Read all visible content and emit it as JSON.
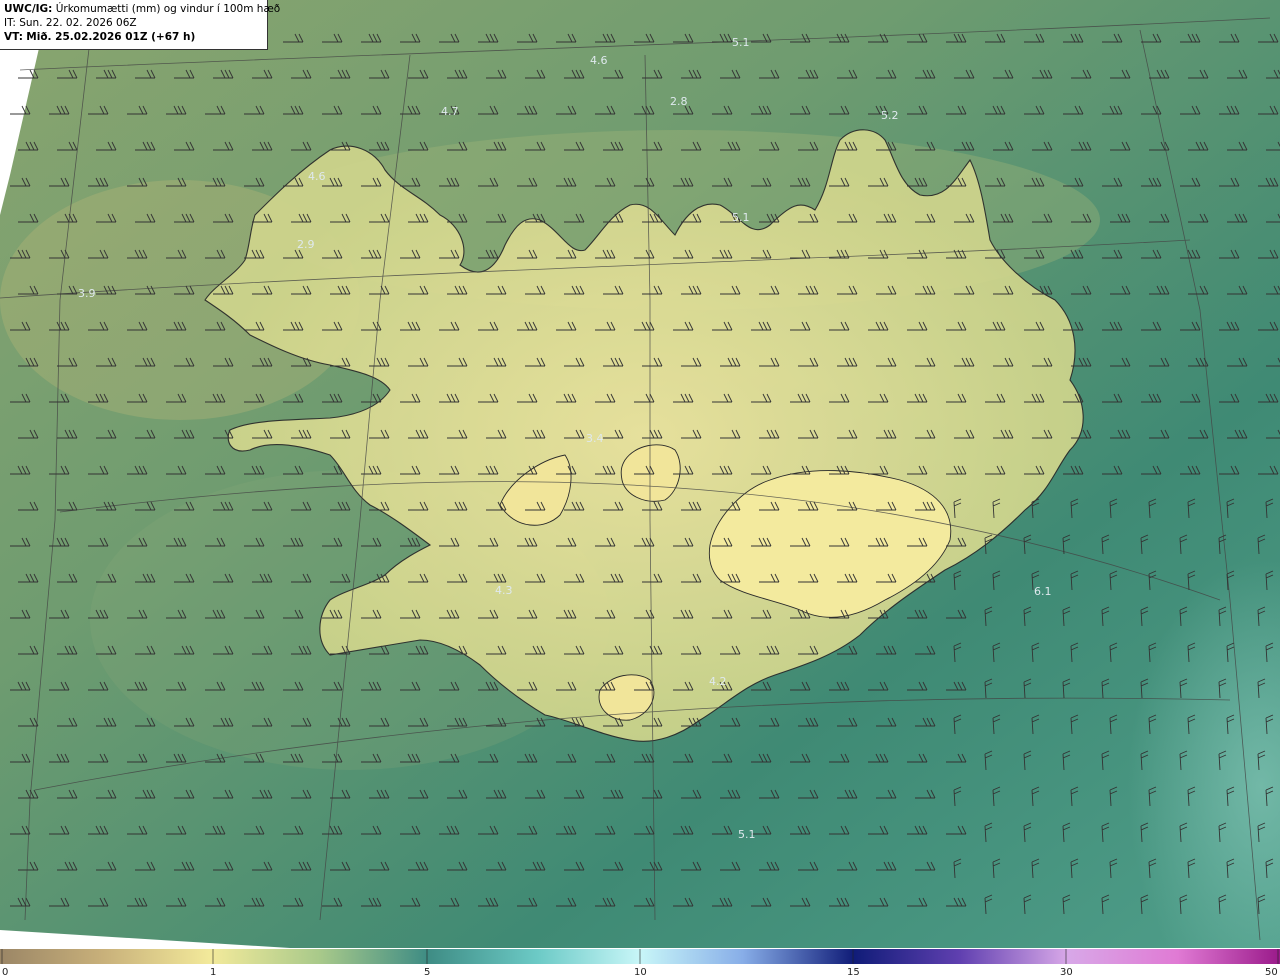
{
  "header": {
    "title_code": "UWC/IG:",
    "title_text": "Úrkomumætti (mm) og vindur í 100m hæð",
    "it_line": "IT: Sun. 22. 02. 2026 06Z",
    "vt_code": "VT:",
    "vt_text": "Mið. 25.02.2026 01Z (+67 h)"
  },
  "max_labels": [
    "5.1",
    "4.6",
    "2.8",
    "4.7",
    "5.2",
    "4.6",
    "5.1",
    "2.9",
    "3.9",
    "3.4",
    "4.3",
    "6.1",
    "4.2",
    "5.1"
  ],
  "colorbar": {
    "ticks": [
      "0",
      "1",
      "5",
      "10",
      "15",
      "30",
      "50"
    ],
    "colors": [
      "#a08a68",
      "#c9b27a",
      "#f4ec9a",
      "#c9d98a",
      "#5f9a7a",
      "#3f8c86",
      "#5fc2c2",
      "#bff4f8",
      "#8fb3e8",
      "#2a2aa0",
      "#0a1a70",
      "#6a48b8",
      "#c89ae0",
      "#f0b0f0",
      "#e070d0",
      "#a02090"
    ]
  },
  "colors": {
    "land": "#efe49a",
    "sea": "#3e8a76",
    "coastline": "#2a2a2a",
    "barb": "#333333",
    "graticule": "#444444"
  }
}
